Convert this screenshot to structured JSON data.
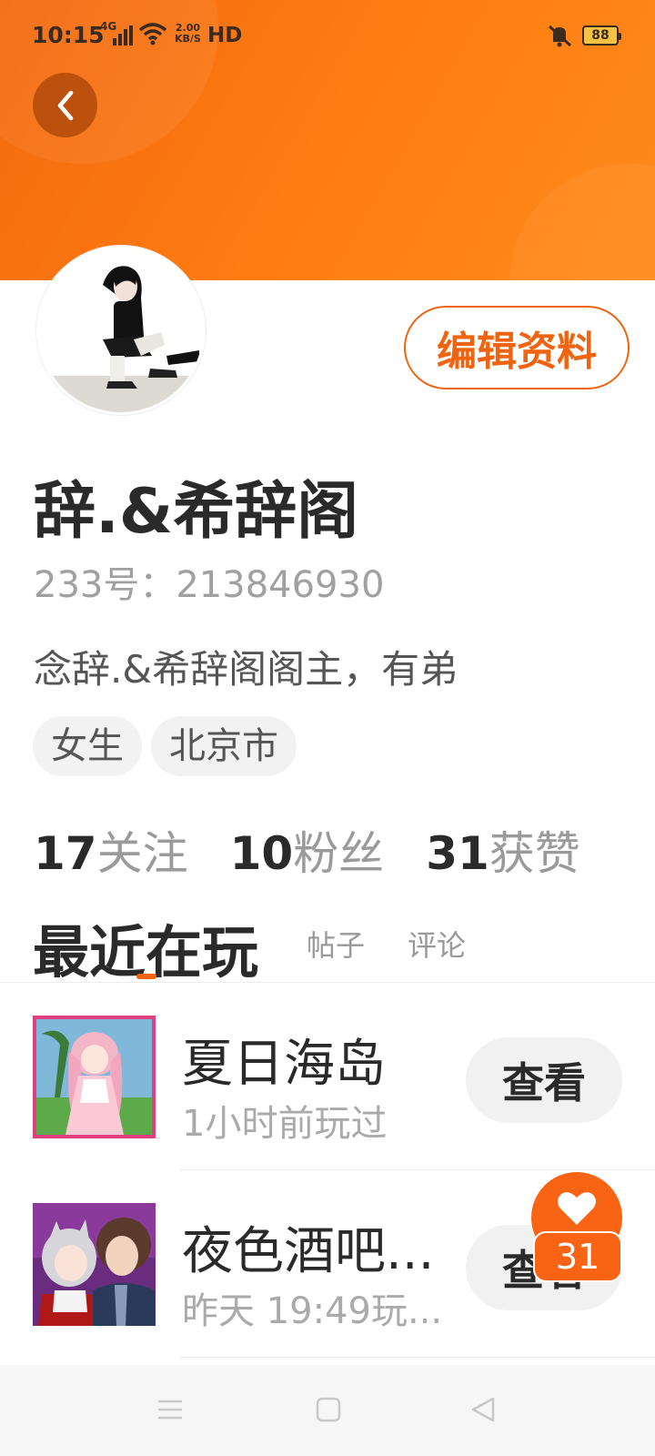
{
  "status": {
    "time": "10:15",
    "network": "4G",
    "speed_top": "2.00",
    "speed_bottom": "KB/S",
    "hd": "HD",
    "battery": "88"
  },
  "profile": {
    "username": "辞.&希辞阁",
    "id_text": "233号：213846930",
    "bio": "念辞.&希辞阁阁主，有弟",
    "tags": [
      "女生",
      "北京市"
    ],
    "edit_label": "编辑资料"
  },
  "stats": [
    {
      "value": "17",
      "label": "关注"
    },
    {
      "value": "10",
      "label": "粉丝"
    },
    {
      "value": "31",
      "label": "获赞"
    }
  ],
  "tabs": {
    "active": "最近在玩",
    "posts": "帖子",
    "comments": "评论"
  },
  "games": [
    {
      "title": "夏日海岛",
      "subtitle": "1小时前玩过",
      "button": "查看"
    },
    {
      "title": "夜色酒吧...",
      "subtitle": "昨天 19:49玩...",
      "button": "查看"
    }
  ],
  "like_count": "31",
  "colors": {
    "accent": "#f0640f",
    "header_start": "#f36a10",
    "header_end": "#ff8a1c"
  }
}
